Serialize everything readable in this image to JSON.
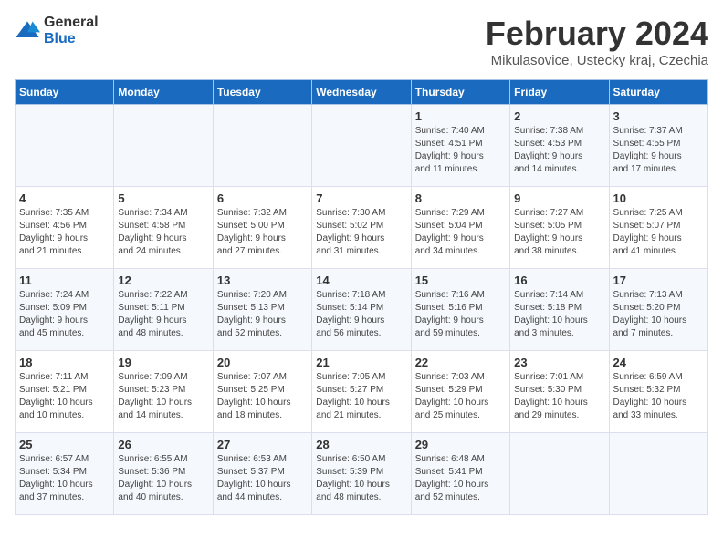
{
  "logo": {
    "general": "General",
    "blue": "Blue"
  },
  "header": {
    "title": "February 2024",
    "subtitle": "Mikulasovice, Ustecky kraj, Czechia"
  },
  "days_of_week": [
    "Sunday",
    "Monday",
    "Tuesday",
    "Wednesday",
    "Thursday",
    "Friday",
    "Saturday"
  ],
  "weeks": [
    [
      {
        "day": "",
        "info": ""
      },
      {
        "day": "",
        "info": ""
      },
      {
        "day": "",
        "info": ""
      },
      {
        "day": "",
        "info": ""
      },
      {
        "day": "1",
        "info": "Sunrise: 7:40 AM\nSunset: 4:51 PM\nDaylight: 9 hours\nand 11 minutes."
      },
      {
        "day": "2",
        "info": "Sunrise: 7:38 AM\nSunset: 4:53 PM\nDaylight: 9 hours\nand 14 minutes."
      },
      {
        "day": "3",
        "info": "Sunrise: 7:37 AM\nSunset: 4:55 PM\nDaylight: 9 hours\nand 17 minutes."
      }
    ],
    [
      {
        "day": "4",
        "info": "Sunrise: 7:35 AM\nSunset: 4:56 PM\nDaylight: 9 hours\nand 21 minutes."
      },
      {
        "day": "5",
        "info": "Sunrise: 7:34 AM\nSunset: 4:58 PM\nDaylight: 9 hours\nand 24 minutes."
      },
      {
        "day": "6",
        "info": "Sunrise: 7:32 AM\nSunset: 5:00 PM\nDaylight: 9 hours\nand 27 minutes."
      },
      {
        "day": "7",
        "info": "Sunrise: 7:30 AM\nSunset: 5:02 PM\nDaylight: 9 hours\nand 31 minutes."
      },
      {
        "day": "8",
        "info": "Sunrise: 7:29 AM\nSunset: 5:04 PM\nDaylight: 9 hours\nand 34 minutes."
      },
      {
        "day": "9",
        "info": "Sunrise: 7:27 AM\nSunset: 5:05 PM\nDaylight: 9 hours\nand 38 minutes."
      },
      {
        "day": "10",
        "info": "Sunrise: 7:25 AM\nSunset: 5:07 PM\nDaylight: 9 hours\nand 41 minutes."
      }
    ],
    [
      {
        "day": "11",
        "info": "Sunrise: 7:24 AM\nSunset: 5:09 PM\nDaylight: 9 hours\nand 45 minutes."
      },
      {
        "day": "12",
        "info": "Sunrise: 7:22 AM\nSunset: 5:11 PM\nDaylight: 9 hours\nand 48 minutes."
      },
      {
        "day": "13",
        "info": "Sunrise: 7:20 AM\nSunset: 5:13 PM\nDaylight: 9 hours\nand 52 minutes."
      },
      {
        "day": "14",
        "info": "Sunrise: 7:18 AM\nSunset: 5:14 PM\nDaylight: 9 hours\nand 56 minutes."
      },
      {
        "day": "15",
        "info": "Sunrise: 7:16 AM\nSunset: 5:16 PM\nDaylight: 9 hours\nand 59 minutes."
      },
      {
        "day": "16",
        "info": "Sunrise: 7:14 AM\nSunset: 5:18 PM\nDaylight: 10 hours\nand 3 minutes."
      },
      {
        "day": "17",
        "info": "Sunrise: 7:13 AM\nSunset: 5:20 PM\nDaylight: 10 hours\nand 7 minutes."
      }
    ],
    [
      {
        "day": "18",
        "info": "Sunrise: 7:11 AM\nSunset: 5:21 PM\nDaylight: 10 hours\nand 10 minutes."
      },
      {
        "day": "19",
        "info": "Sunrise: 7:09 AM\nSunset: 5:23 PM\nDaylight: 10 hours\nand 14 minutes."
      },
      {
        "day": "20",
        "info": "Sunrise: 7:07 AM\nSunset: 5:25 PM\nDaylight: 10 hours\nand 18 minutes."
      },
      {
        "day": "21",
        "info": "Sunrise: 7:05 AM\nSunset: 5:27 PM\nDaylight: 10 hours\nand 21 minutes."
      },
      {
        "day": "22",
        "info": "Sunrise: 7:03 AM\nSunset: 5:29 PM\nDaylight: 10 hours\nand 25 minutes."
      },
      {
        "day": "23",
        "info": "Sunrise: 7:01 AM\nSunset: 5:30 PM\nDaylight: 10 hours\nand 29 minutes."
      },
      {
        "day": "24",
        "info": "Sunrise: 6:59 AM\nSunset: 5:32 PM\nDaylight: 10 hours\nand 33 minutes."
      }
    ],
    [
      {
        "day": "25",
        "info": "Sunrise: 6:57 AM\nSunset: 5:34 PM\nDaylight: 10 hours\nand 37 minutes."
      },
      {
        "day": "26",
        "info": "Sunrise: 6:55 AM\nSunset: 5:36 PM\nDaylight: 10 hours\nand 40 minutes."
      },
      {
        "day": "27",
        "info": "Sunrise: 6:53 AM\nSunset: 5:37 PM\nDaylight: 10 hours\nand 44 minutes."
      },
      {
        "day": "28",
        "info": "Sunrise: 6:50 AM\nSunset: 5:39 PM\nDaylight: 10 hours\nand 48 minutes."
      },
      {
        "day": "29",
        "info": "Sunrise: 6:48 AM\nSunset: 5:41 PM\nDaylight: 10 hours\nand 52 minutes."
      },
      {
        "day": "",
        "info": ""
      },
      {
        "day": "",
        "info": ""
      }
    ]
  ]
}
